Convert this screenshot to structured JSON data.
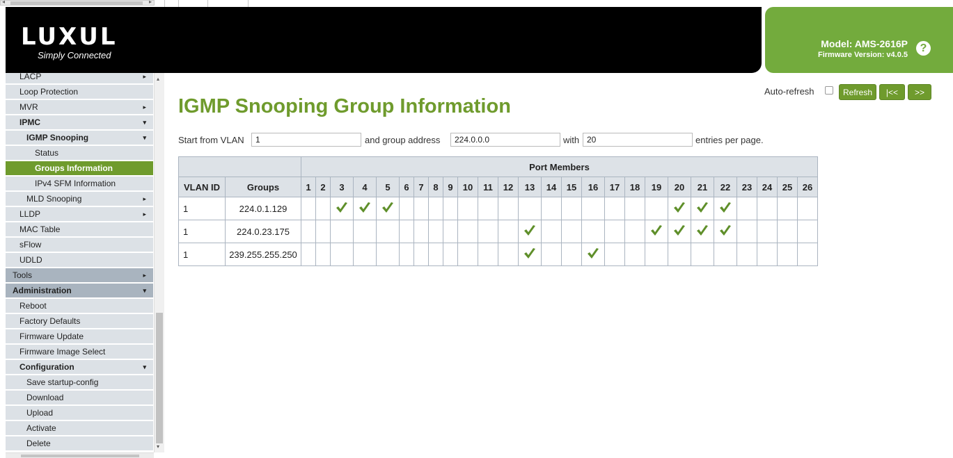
{
  "header": {
    "logo_brand": "LUXUL",
    "logo_tagline": "Simply Connected",
    "model": "Model: AMS-2616P",
    "firmware": "Firmware Version: v4.0.5"
  },
  "sidebar": {
    "items": [
      {
        "label": "LACP",
        "level": 1,
        "arrow": "▸"
      },
      {
        "label": "Loop Protection",
        "level": 1,
        "arrow": ""
      },
      {
        "label": "MVR",
        "level": 1,
        "arrow": "▸"
      },
      {
        "label": "IPMC",
        "level": 1,
        "arrow": "▾",
        "bold": true
      },
      {
        "label": "IGMP Snooping",
        "level": 2,
        "arrow": "▾",
        "bold": true
      },
      {
        "label": "Status",
        "level": 3,
        "arrow": ""
      },
      {
        "label": "Groups Information",
        "level": 3,
        "arrow": "",
        "active": true
      },
      {
        "label": "IPv4 SFM Information",
        "level": 3,
        "arrow": ""
      },
      {
        "label": "MLD Snooping",
        "level": 2,
        "arrow": "▸"
      },
      {
        "label": "LLDP",
        "level": 1,
        "arrow": "▸"
      },
      {
        "label": "MAC Table",
        "level": 1,
        "arrow": ""
      },
      {
        "label": "sFlow",
        "level": 1,
        "arrow": ""
      },
      {
        "label": "UDLD",
        "level": 1,
        "arrow": ""
      },
      {
        "label": "Tools",
        "level": 0,
        "arrow": "▸"
      },
      {
        "label": "Administration",
        "level": 0,
        "arrow": "▾",
        "bold": true
      },
      {
        "label": "Reboot",
        "level": 1,
        "arrow": ""
      },
      {
        "label": "Factory Defaults",
        "level": 1,
        "arrow": ""
      },
      {
        "label": "Firmware Update",
        "level": 1,
        "arrow": ""
      },
      {
        "label": "Firmware Image Select",
        "level": 1,
        "arrow": ""
      },
      {
        "label": "Configuration",
        "level": 1,
        "arrow": "▾",
        "bold": true
      },
      {
        "label": "Save startup-config",
        "level": 2,
        "arrow": ""
      },
      {
        "label": "Download",
        "level": 2,
        "arrow": ""
      },
      {
        "label": "Upload",
        "level": 2,
        "arrow": ""
      },
      {
        "label": "Activate",
        "level": 2,
        "arrow": ""
      },
      {
        "label": "Delete",
        "level": 2,
        "arrow": ""
      }
    ]
  },
  "main": {
    "title": "IGMP Snooping Group Information",
    "auto_refresh_label": "Auto-refresh",
    "auto_refresh_checked": false,
    "refresh_label": "Refresh",
    "first_label": "|<<",
    "next_label": ">>",
    "filter": {
      "start_text": "Start from VLAN",
      "vlan_value": "1",
      "group_text": "and group address",
      "group_value": "224.0.0.0",
      "with_text": "with",
      "entries_value": "20",
      "entries_text": "entries per page."
    },
    "table": {
      "port_members_header": "Port Members",
      "vlan_header": "VLAN ID",
      "groups_header": "Groups",
      "ports": [
        "1",
        "2",
        "3",
        "4",
        "5",
        "6",
        "7",
        "8",
        "9",
        "10",
        "11",
        "12",
        "13",
        "14",
        "15",
        "16",
        "17",
        "18",
        "19",
        "20",
        "21",
        "22",
        "23",
        "24",
        "25",
        "26"
      ],
      "rows": [
        {
          "vlan": "1",
          "group": "224.0.1.129",
          "members": [
            3,
            4,
            5,
            20,
            21,
            22
          ]
        },
        {
          "vlan": "1",
          "group": "224.0.23.175",
          "members": [
            13,
            19,
            20,
            21,
            22
          ]
        },
        {
          "vlan": "1",
          "group": "239.255.255.250",
          "members": [
            13,
            16
          ]
        }
      ]
    },
    "check_color": "#5f8f2a"
  }
}
